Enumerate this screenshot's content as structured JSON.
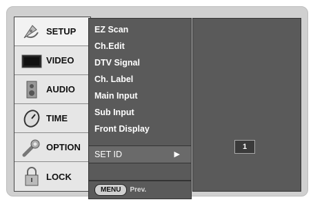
{
  "sidebar": {
    "items": [
      {
        "label": "SETUP",
        "icon": "satellite-dish-icon",
        "selected": true
      },
      {
        "label": "VIDEO",
        "icon": "tv-icon",
        "selected": false
      },
      {
        "label": "AUDIO",
        "icon": "speaker-icon",
        "selected": false
      },
      {
        "label": "TIME",
        "icon": "clock-icon",
        "selected": false
      },
      {
        "label": "OPTION",
        "icon": "wrench-icon",
        "selected": false
      },
      {
        "label": "LOCK",
        "icon": "padlock-icon",
        "selected": false
      }
    ]
  },
  "menu": {
    "items": [
      "EZ Scan",
      "Ch.Edit",
      "DTV Signal",
      "Ch. Label",
      "Main Input",
      "Sub Input",
      "Front Display"
    ],
    "selected_label": "SET ID",
    "selected_arrow": "▶",
    "footer_button": "MENU",
    "footer_text": "Prev."
  },
  "panel": {
    "set_id_value": "1"
  },
  "colors": {
    "panel_bg": "#5a5a5a",
    "sidebar_bg": "#e6e6e6",
    "frame_bg": "#d0d0d0"
  }
}
